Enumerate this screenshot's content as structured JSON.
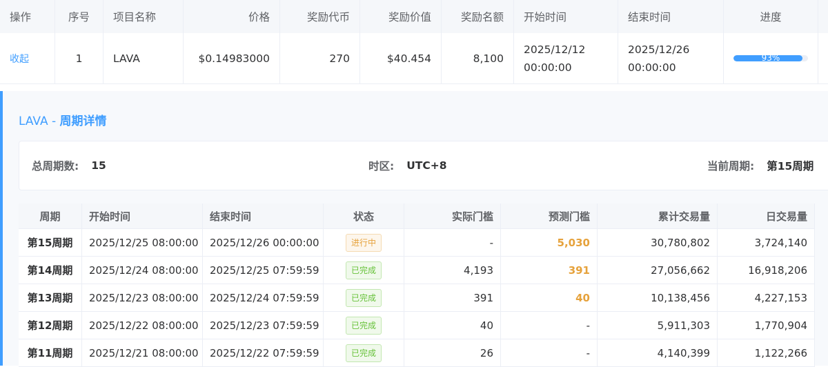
{
  "top_table": {
    "headers": [
      "操作",
      "序号",
      "项目名称",
      "价格",
      "奖励代币",
      "奖励价值",
      "奖励名额",
      "开始时间",
      "结束时间",
      "进度"
    ],
    "row": {
      "action": "收起",
      "index": "1",
      "project": "LAVA",
      "price": "$0.14983000",
      "reward_token": "270",
      "reward_value": "$40.454",
      "reward_slots": "8,100",
      "start_date": "2025/12/12",
      "start_time": "00:00:00",
      "end_date": "2025/12/26",
      "end_time": "00:00:00",
      "progress_text": "93%",
      "progress_fraction": 0.93
    }
  },
  "detail": {
    "title_project": "LAVA",
    "title_sep": " - ",
    "title_suffix": "周期详情",
    "summary": {
      "total_label": "总周期数:",
      "total_value": "15",
      "tz_label": "时区:",
      "tz_value": "UTC+8",
      "current_label": "当前周期:",
      "current_value": "第15周期"
    },
    "period_headers": [
      "周期",
      "开始时间",
      "结束时间",
      "状态",
      "实际门槛",
      "预测门槛",
      "累计交易量",
      "日交易量"
    ],
    "periods": [
      {
        "period": "第15周期",
        "start": "2025/12/25 08:00:00",
        "end": "2025/12/26 00:00:00",
        "status": "进行中",
        "status_kind": "progress",
        "actual": "-",
        "predicted": "5,030",
        "predicted_highlight": true,
        "cumulative": "30,780,802",
        "daily": "3,724,140"
      },
      {
        "period": "第14周期",
        "start": "2025/12/24 08:00:00",
        "end": "2025/12/25 07:59:59",
        "status": "已完成",
        "status_kind": "done",
        "actual": "4,193",
        "predicted": "391",
        "predicted_highlight": true,
        "cumulative": "27,056,662",
        "daily": "16,918,206"
      },
      {
        "period": "第13周期",
        "start": "2025/12/23 08:00:00",
        "end": "2025/12/24 07:59:59",
        "status": "已完成",
        "status_kind": "done",
        "actual": "391",
        "predicted": "40",
        "predicted_highlight": true,
        "cumulative": "10,138,456",
        "daily": "4,227,153"
      },
      {
        "period": "第12周期",
        "start": "2025/12/22 08:00:00",
        "end": "2025/12/23 07:59:59",
        "status": "已完成",
        "status_kind": "done",
        "actual": "40",
        "predicted": "-",
        "predicted_highlight": false,
        "cumulative": "5,911,303",
        "daily": "1,770,904"
      },
      {
        "period": "第11周期",
        "start": "2025/12/21 08:00:00",
        "end": "2025/12/22 07:59:59",
        "status": "已完成",
        "status_kind": "done",
        "actual": "26",
        "predicted": "-",
        "predicted_highlight": false,
        "cumulative": "4,140,399",
        "daily": "1,122,266"
      }
    ]
  },
  "colors": {
    "accent": "#409eff",
    "status_progress": "#e6a23c",
    "status_done": "#67c23a"
  }
}
